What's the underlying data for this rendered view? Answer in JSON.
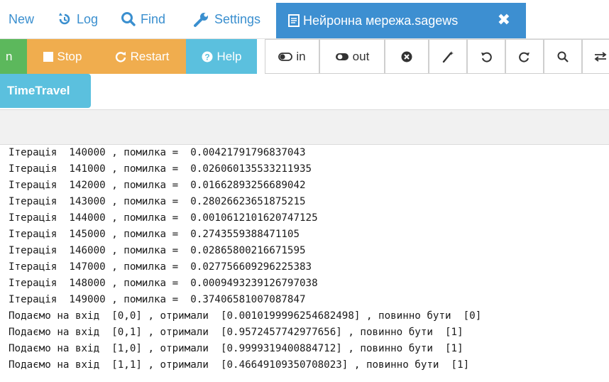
{
  "nav": {
    "new_label": "New",
    "log_label": "Log",
    "find_label": "Find",
    "settings_label": "Settings",
    "active_tab_label": "Нейронна мережа.sagews",
    "close_symbol": "✖"
  },
  "toolbar": {
    "run_label": "n",
    "stop_label": "Stop",
    "restart_label": "Restart",
    "help_label": "Help",
    "zoom_in_label": "in",
    "zoom_out_label": "out",
    "colors": {
      "green": "#5cb85c",
      "orange": "#f0ad4e",
      "blue": "#5bc0de",
      "tab_blue": "#3d8fd1"
    }
  },
  "timetravel_label": "TimeTravel",
  "output": {
    "lines": [
      "Ітерація  140000 , помилка =  0.00421791796837043",
      "Ітерація  141000 , помилка =  0.026060135533211935",
      "Ітерація  142000 , помилка =  0.01662893256689042",
      "Ітерація  143000 , помилка =  0.28026623651875215",
      "Ітерація  144000 , помилка =  0.0010612101620747125",
      "Ітерація  145000 , помилка =  0.2743559388471105",
      "Ітерація  146000 , помилка =  0.02865800216671595",
      "Ітерація  147000 , помилка =  0.027756609296225383",
      "Ітерація  148000 , помилка =  0.0009493239126797038",
      "Ітерація  149000 , помилка =  0.37406581007087847",
      "Подаємо на вхід  [0,0] , отримали  [0.0010199996254682498] , повинно бути  [0]",
      "Подаємо на вхід  [0,1] , отримали  [0.9572457742977656] , повинно бути  [1]",
      "Подаємо на вхід  [1,0] , отримали  [0.9999319400884712] , повинно бути  [1]",
      "Подаємо на вхід  [1,1] , отримали  [0.46649109350708023] , повинно бути  [1]"
    ]
  }
}
